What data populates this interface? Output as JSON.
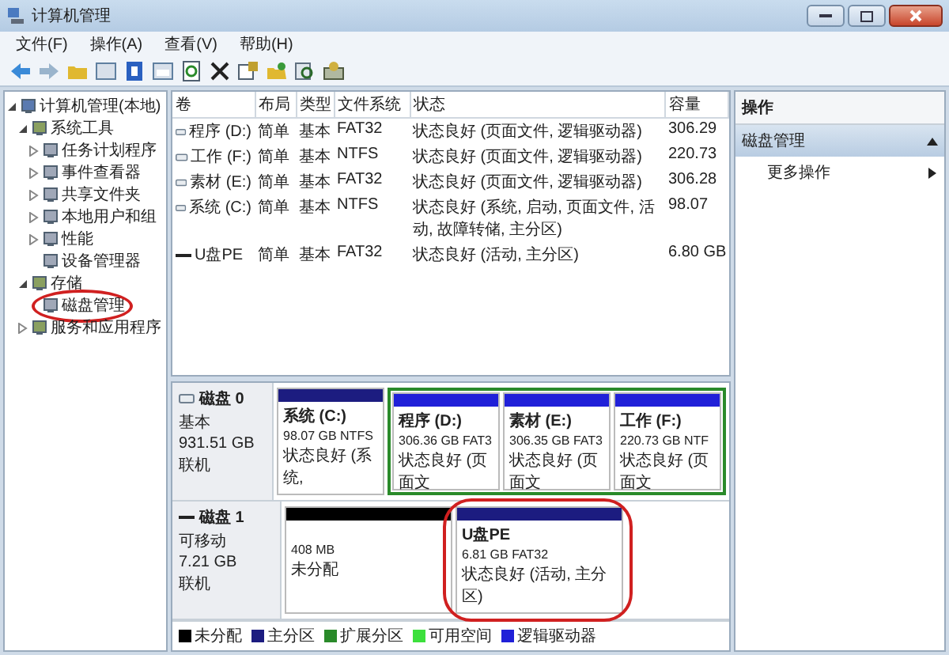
{
  "window": {
    "title": "计算机管理"
  },
  "menu": [
    "文件(F)",
    "操作(A)",
    "查看(V)",
    "帮助(H)"
  ],
  "tree": {
    "items": [
      {
        "label": "计算机管理(本地)",
        "expanded": true,
        "circled": false,
        "children": [
          {
            "label": "系统工具",
            "expanded": true,
            "circled": false,
            "children": [
              {
                "label": "任务计划程序",
                "expanded": false,
                "circled": false
              },
              {
                "label": "事件查看器",
                "expanded": false,
                "circled": false
              },
              {
                "label": "共享文件夹",
                "expanded": false,
                "circled": false
              },
              {
                "label": "本地用户和组",
                "expanded": false,
                "circled": false
              },
              {
                "label": "性能",
                "expanded": false,
                "circled": false
              },
              {
                "label": "设备管理器",
                "circled": false
              }
            ]
          },
          {
            "label": "存储",
            "expanded": true,
            "circled": false,
            "children": [
              {
                "label": "磁盘管理",
                "circled": true
              }
            ]
          },
          {
            "label": "服务和应用程序",
            "expanded": false,
            "circled": false
          }
        ]
      }
    ]
  },
  "table": {
    "columns": [
      "卷",
      "布局",
      "类型",
      "文件系统",
      "状态",
      "容量"
    ],
    "rows": [
      {
        "kind": "drive",
        "cells": [
          "程序 (D:)",
          "简单",
          "基本",
          "FAT32",
          "状态良好 (页面文件, 逻辑驱动器)",
          "306.29"
        ]
      },
      {
        "kind": "drive",
        "cells": [
          "工作 (F:)",
          "简单",
          "基本",
          "NTFS",
          "状态良好 (页面文件, 逻辑驱动器)",
          "220.73"
        ]
      },
      {
        "kind": "drive",
        "cells": [
          "素材 (E:)",
          "简单",
          "基本",
          "FAT32",
          "状态良好 (页面文件, 逻辑驱动器)",
          "306.28"
        ]
      },
      {
        "kind": "drive",
        "cells": [
          "系统 (C:)",
          "简单",
          "基本",
          "NTFS",
          "状态良好 (系统, 启动, 页面文件, 活动, 故障转储, 主分区)",
          "98.07"
        ]
      },
      {
        "kind": "removable",
        "cells": [
          "U盘PE",
          "简单",
          "基本",
          "FAT32",
          "状态良好 (活动, 主分区)",
          "6.80 GB"
        ]
      }
    ]
  },
  "disks": [
    {
      "kind": "basic",
      "name": "磁盘 0",
      "type": "基本",
      "size": "931.51 GB",
      "state": "联机",
      "partitions": [
        {
          "kind": "primary",
          "circled": false,
          "name": "系统 (C:)",
          "size": "98.07 GB NTFS",
          "status": "状态良好 (系统,"
        },
        {
          "kind": "logical",
          "circled": false,
          "name": "程序 (D:)",
          "size": "306.36 GB FAT3",
          "status": "状态良好 (页面文"
        },
        {
          "kind": "logical",
          "circled": false,
          "name": "素材 (E:)",
          "size": "306.35 GB FAT3",
          "status": "状态良好 (页面文"
        },
        {
          "kind": "logical",
          "circled": false,
          "name": "工作 (F:)",
          "size": "220.73 GB NTF",
          "status": "状态良好 (页面文"
        }
      ]
    },
    {
      "kind": "removable",
      "name": "磁盘 1",
      "type": "可移动",
      "size": "7.21 GB",
      "state": "联机",
      "partitions": [
        {
          "kind": "unallocated",
          "circled": false,
          "size": "408 MB",
          "status": "未分配"
        },
        {
          "kind": "primary",
          "circled": true,
          "name": "U盘PE",
          "size": "6.81 GB FAT32",
          "status": "状态良好 (活动, 主分区)"
        }
      ]
    }
  ],
  "legend": [
    {
      "label": "未分配",
      "color": "#000000"
    },
    {
      "label": "主分区",
      "color": "#1c1c80"
    },
    {
      "label": "扩展分区",
      "color": "#2a8a2a"
    },
    {
      "label": "可用空间",
      "color": "#3ce03c"
    },
    {
      "label": "逻辑驱动器",
      "color": "#2020d8"
    }
  ],
  "actions": {
    "title": "操作",
    "section": {
      "label": "磁盘管理",
      "expanded": true
    },
    "items": [
      "更多操作"
    ]
  }
}
